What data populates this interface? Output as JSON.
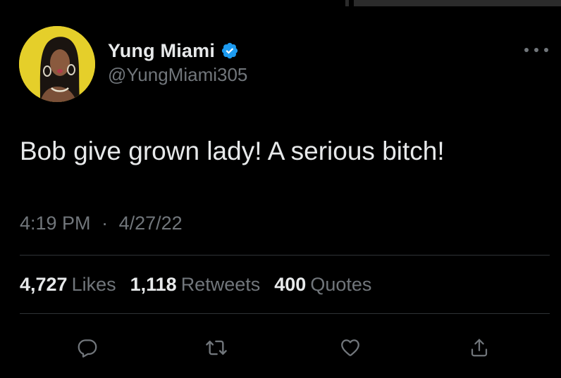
{
  "author": {
    "display_name": "Yung Miami",
    "handle": "@YungMiami305",
    "verified": true
  },
  "tweet": {
    "text": "Bob give grown lady! A serious bitch!",
    "time": "4:19 PM",
    "separator": "·",
    "date": "4/27/22"
  },
  "stats": {
    "likes_count": "4,727",
    "likes_label": "Likes",
    "retweets_count": "1,118",
    "retweets_label": "Retweets",
    "quotes_count": "400",
    "quotes_label": "Quotes"
  },
  "actions": {
    "icons": [
      "reply-icon",
      "retweet-icon",
      "like-icon",
      "share-icon"
    ]
  },
  "colors": {
    "background": "#000000",
    "text_primary": "#e7e9ea",
    "text_secondary": "#71767b",
    "verified_blue": "#1d9bf0",
    "divider": "#2f3336",
    "avatar_bg": "#e5cf2a"
  }
}
